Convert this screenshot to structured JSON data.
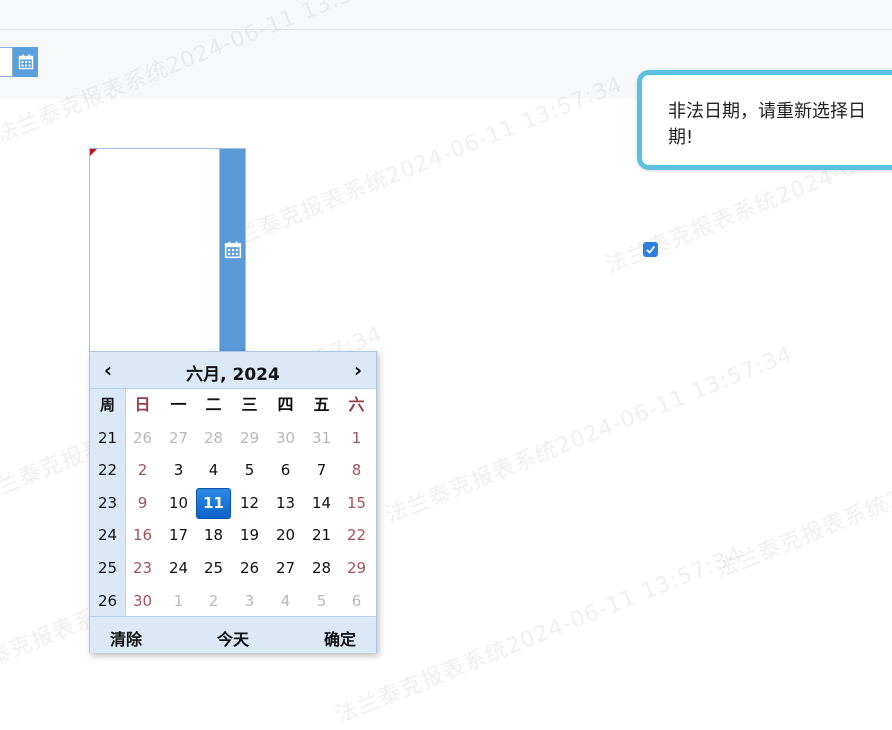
{
  "watermark_text": "法兰泰克报表系统2024-06-11 13:57:34",
  "tooltip": {
    "message": "非法日期，请重新选择日期!"
  },
  "checkbox": {
    "checked": true
  },
  "datepicker": {
    "title": "六月, 2024",
    "prev_label": "‹",
    "next_label": "›",
    "week_header": "周",
    "day_headers": [
      "日",
      "一",
      "二",
      "三",
      "四",
      "五",
      "六"
    ],
    "week_numbers": [
      "21",
      "22",
      "23",
      "24",
      "25",
      "26"
    ],
    "weeks": [
      [
        "26",
        "27",
        "28",
        "29",
        "30",
        "31",
        "1"
      ],
      [
        "2",
        "3",
        "4",
        "5",
        "6",
        "7",
        "8"
      ],
      [
        "9",
        "10",
        "11",
        "12",
        "13",
        "14",
        "15"
      ],
      [
        "16",
        "17",
        "18",
        "19",
        "20",
        "21",
        "22"
      ],
      [
        "23",
        "24",
        "25",
        "26",
        "27",
        "28",
        "29"
      ],
      [
        "30",
        "1",
        "2",
        "3",
        "4",
        "5",
        "6"
      ]
    ],
    "selected_day": "11",
    "footer": {
      "clear": "清除",
      "today": "今天",
      "confirm": "确定"
    }
  },
  "colors": {
    "accent": "#5aa0dd",
    "header_bg": "#dbe8f7",
    "weekend": "#a4525c",
    "selected": "#1a74d8",
    "tooltip_border": "#5bc0de"
  },
  "icons": {
    "calendar": "calendar-icon",
    "check": "check-icon"
  }
}
